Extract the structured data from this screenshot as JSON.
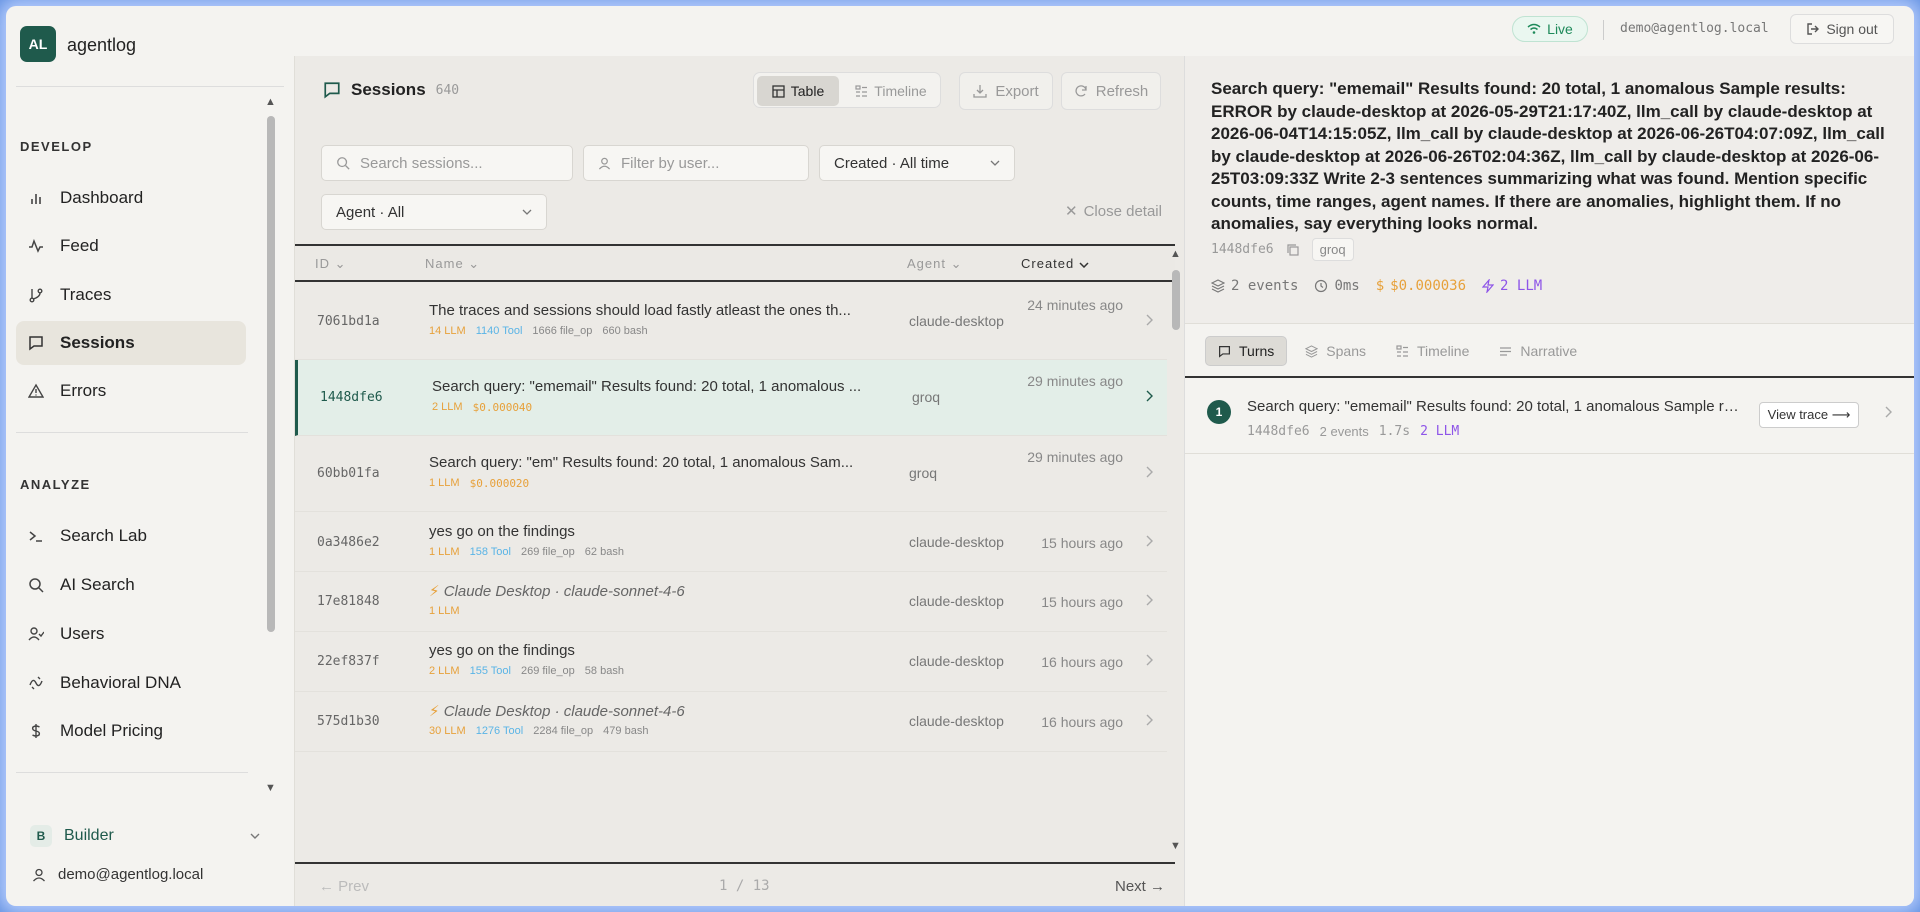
{
  "app": {
    "logo": "AL",
    "name": "agentlog"
  },
  "topbar": {
    "live": "Live",
    "email": "demo@agentlog.local",
    "signout": "Sign out"
  },
  "sidebar": {
    "develop_label": "DEVELOP",
    "develop": [
      {
        "label": "Dashboard",
        "icon": "bar-chart-icon"
      },
      {
        "label": "Feed",
        "icon": "activity-icon"
      },
      {
        "label": "Traces",
        "icon": "branch-icon"
      },
      {
        "label": "Sessions",
        "icon": "message-icon",
        "active": true
      },
      {
        "label": "Errors",
        "icon": "warning-icon"
      }
    ],
    "analyze_label": "ANALYZE",
    "analyze": [
      {
        "label": "Search Lab",
        "icon": "terminal-icon"
      },
      {
        "label": "AI Search",
        "icon": "search-icon"
      },
      {
        "label": "Users",
        "icon": "users-icon"
      },
      {
        "label": "Behavioral DNA",
        "icon": "dna-icon"
      },
      {
        "label": "Model Pricing",
        "icon": "dollar-icon"
      }
    ],
    "builder_badge": "B",
    "builder": "Builder",
    "user_email": "demo@agentlog.local"
  },
  "sessions": {
    "title": "Sessions",
    "count": "640",
    "view_table": "Table",
    "view_timeline": "Timeline",
    "export": "Export",
    "refresh": "Refresh",
    "search_placeholder": "Search sessions...",
    "user_placeholder": "Filter by user...",
    "created_filter": "Created · All time",
    "agent_filter": "Agent · All",
    "close_detail": "Close detail",
    "columns": {
      "id": "ID",
      "name": "Name",
      "agent": "Agent",
      "created": "Created"
    },
    "rows": [
      {
        "id": "7061bd1a",
        "name": "The traces and sessions should load fastly atleast the ones th...",
        "tags": [
          [
            "14 LLM",
            "llm"
          ],
          [
            "1140 Tool",
            "tool"
          ],
          [
            "1666 file_op",
            "file"
          ],
          [
            "660 bash",
            "file"
          ]
        ],
        "agent": "claude-desktop",
        "created": "24 minutes ago",
        "two_line": true
      },
      {
        "id": "1448dfe6",
        "name": "Search query: \"ememail\" Results found: 20 total, 1 anomalous ...",
        "tags": [
          [
            "2 LLM",
            "llm"
          ],
          [
            "$0.000040",
            "cost"
          ]
        ],
        "agent": "groq",
        "created": "29 minutes ago",
        "two_line": true,
        "selected": true
      },
      {
        "id": "60bb01fa",
        "name": "Search query: \"em\" Results found: 20 total, 1 anomalous Sam...",
        "tags": [
          [
            "1 LLM",
            "llm"
          ],
          [
            "$0.000020",
            "cost"
          ]
        ],
        "agent": "groq",
        "created": "29 minutes ago",
        "two_line": true
      },
      {
        "id": "0a3486e2",
        "name": "yes go on the findings",
        "tags": [
          [
            "1 LLM",
            "llm"
          ],
          [
            "158 Tool",
            "tool"
          ],
          [
            "269 file_op",
            "file"
          ],
          [
            "62 bash",
            "file"
          ]
        ],
        "agent": "claude-desktop",
        "created": "15 hours ago"
      },
      {
        "id": "17e81848",
        "name": "Claude Desktop · claude-sonnet-4-6",
        "italic": true,
        "tags": [
          [
            "1 LLM",
            "llm"
          ]
        ],
        "agent": "claude-desktop",
        "created": "15 hours ago"
      },
      {
        "id": "22ef837f",
        "name": "yes go on the findings",
        "tags": [
          [
            "2 LLM",
            "llm"
          ],
          [
            "155 Tool",
            "tool"
          ],
          [
            "269 file_op",
            "file"
          ],
          [
            "58 bash",
            "file"
          ]
        ],
        "agent": "claude-desktop",
        "created": "16 hours ago"
      },
      {
        "id": "575d1b30",
        "name": "Claude Desktop · claude-sonnet-4-6",
        "italic": true,
        "tags": [
          [
            "30 LLM",
            "llm"
          ],
          [
            "1276 Tool",
            "tool"
          ],
          [
            "2284 file_op",
            "file"
          ],
          [
            "479 bash",
            "file"
          ]
        ],
        "agent": "claude-desktop",
        "created": "16 hours ago"
      }
    ],
    "prev": "← Prev",
    "page": "1 / 13",
    "next": "Next →"
  },
  "detail": {
    "title": "Search query: \"ememail\" Results found: 20 total, 1 anomalous Sample results: ERROR by claude-desktop at 2026-05-29T21:17:40Z, llm_call by claude-desktop at 2026-06-04T14:15:05Z, llm_call by claude-desktop at 2026-06-26T04:07:09Z, llm_call by claude-desktop at 2026-06-26T02:04:36Z, llm_call by claude-desktop at 2026-06-25T03:09:33Z Write 2-3 sentences summarizing what was found. Mention specific counts, time ranges, agent names. If there are anomalies, highlight them. If no anomalies, say everything looks normal.",
    "id": "1448dfe6",
    "agent": "groq",
    "events": "2 events",
    "duration": "0ms",
    "cost": "$0.000036",
    "llm": "2 LLM",
    "tabs": [
      "Turns",
      "Spans",
      "Timeline",
      "Narrative"
    ],
    "turn": {
      "num": "1",
      "title": "Search query: \"ememail\" Results found: 20 total, 1 anomalous Sample results: ERROR",
      "id": "1448dfe6",
      "events": "2 events",
      "duration": "1.7s",
      "llm": "2 LLM",
      "view": "View trace ⟶"
    }
  }
}
